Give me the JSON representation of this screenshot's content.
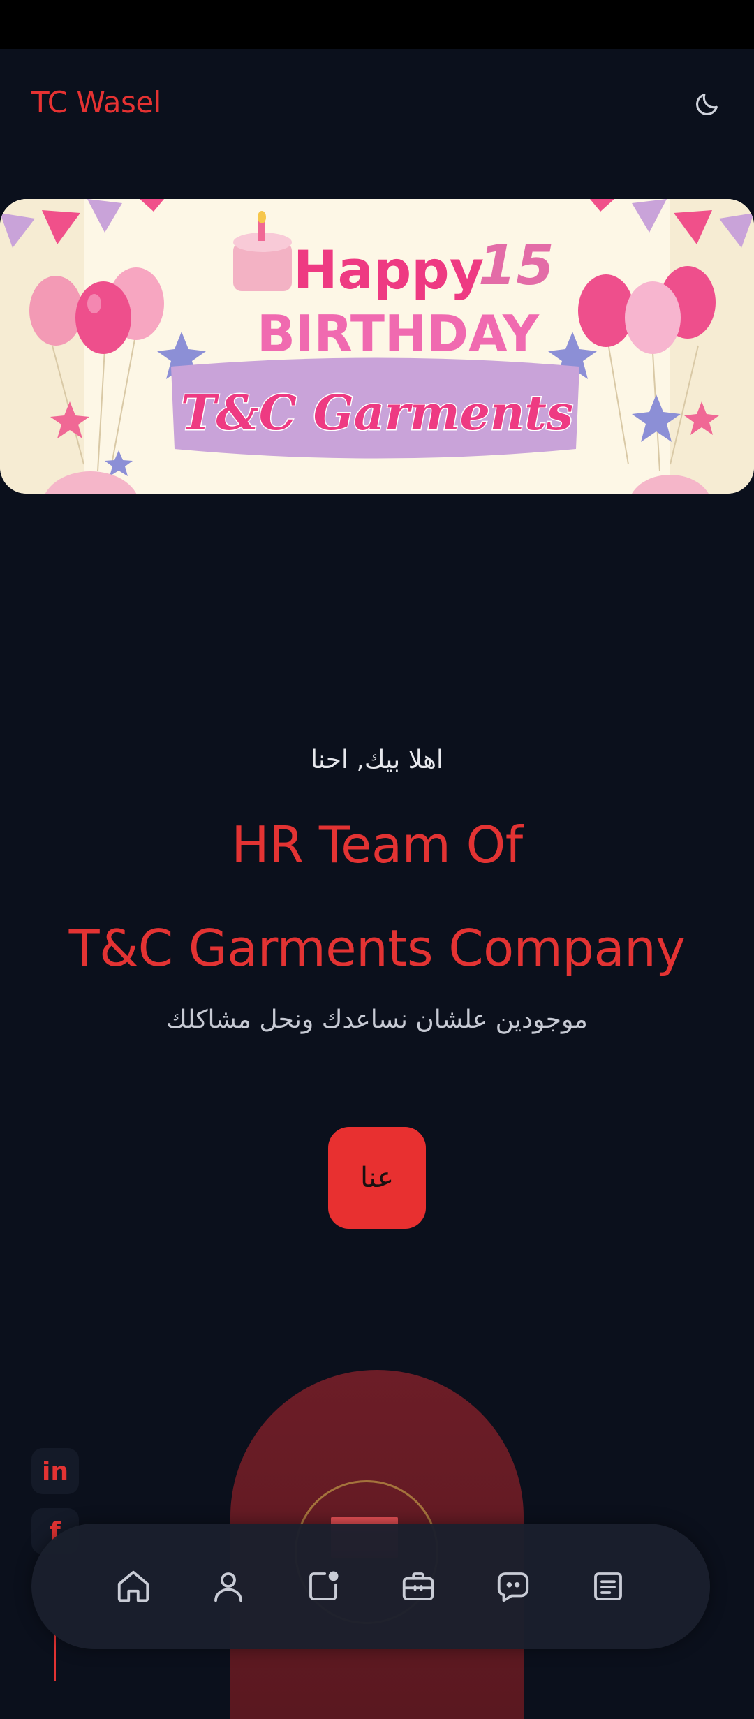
{
  "header": {
    "brand": "TC Wasel",
    "theme_icon": "moon-icon"
  },
  "banner": {
    "happy": "Happy",
    "birthday": "BIRTHDAY",
    "number": "15",
    "ribbon": "T&C Garments"
  },
  "hero": {
    "greeting": "اهلا بيك, احنا",
    "title_line1": "HR Team Of",
    "title_line2": "T&C Garments Company",
    "subtitle": "موجودين علشان نساعدك ونحل مشاكلك",
    "about_button": "عنا"
  },
  "social": {
    "linkedin": "in",
    "facebook": "f"
  },
  "nav": {
    "items": [
      {
        "icon": "home-icon"
      },
      {
        "icon": "user-icon"
      },
      {
        "icon": "notification-icon"
      },
      {
        "icon": "briefcase-icon"
      },
      {
        "icon": "chat-icon"
      },
      {
        "icon": "document-icon"
      }
    ]
  },
  "colors": {
    "background": "#0b101c",
    "accent": "#e63232",
    "nav_background": "#1a1f2d"
  }
}
